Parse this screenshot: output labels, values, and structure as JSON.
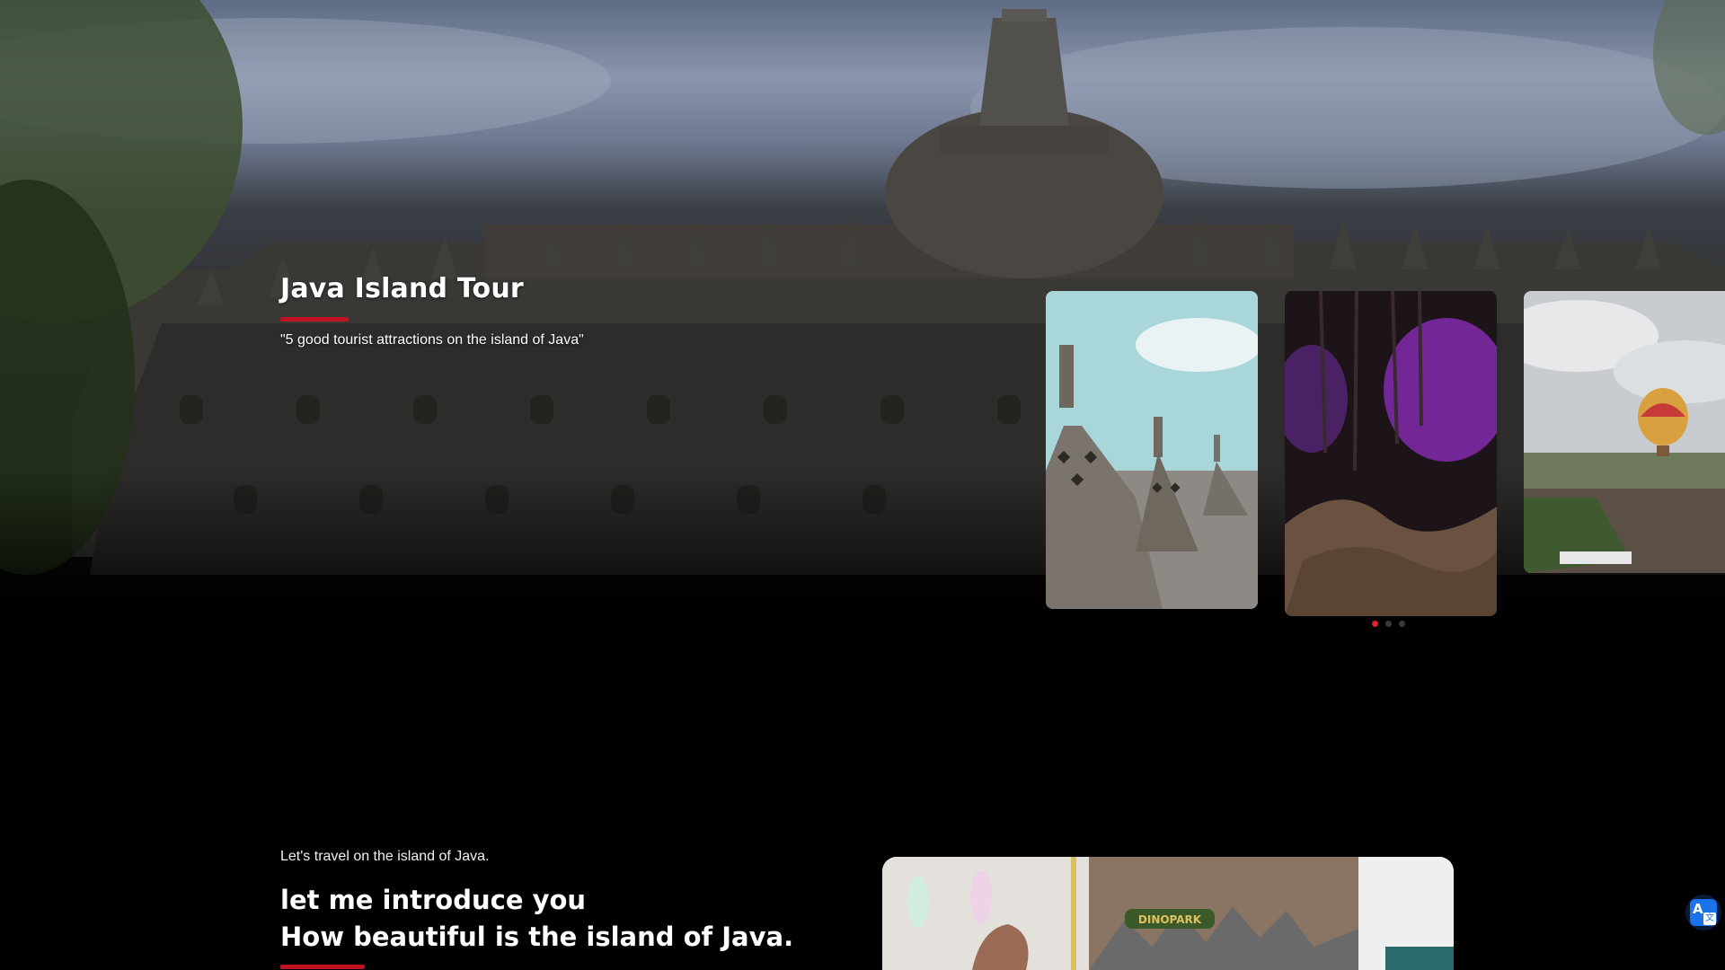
{
  "hero": {
    "title": "Java Island Tour",
    "subtitle": "\"5 good tourist attractions on the island of Java\"",
    "background_icon": "borobudur-temple-image"
  },
  "carousel": {
    "cards": [
      {
        "icon": "borobudur-stupas-image"
      },
      {
        "icon": "purple-lit-cave-image"
      },
      {
        "icon": "hot-air-balloon-hill-image"
      }
    ],
    "dots": [
      true,
      false,
      false
    ],
    "accent_color": "#e0222e"
  },
  "intro": {
    "kicker": "Let's travel on the island of Java.",
    "heading_line1": "let me introduce you",
    "heading_line2": "How beautiful is the island of Java.",
    "image_icon": "dinosaur-park-entrance-image"
  },
  "widgets": {
    "translate_icon": "translate-icon",
    "translate_glyph": "A",
    "translate_glyph2": "文"
  },
  "colors": {
    "accent": "#c1121f",
    "background": "#000000"
  }
}
